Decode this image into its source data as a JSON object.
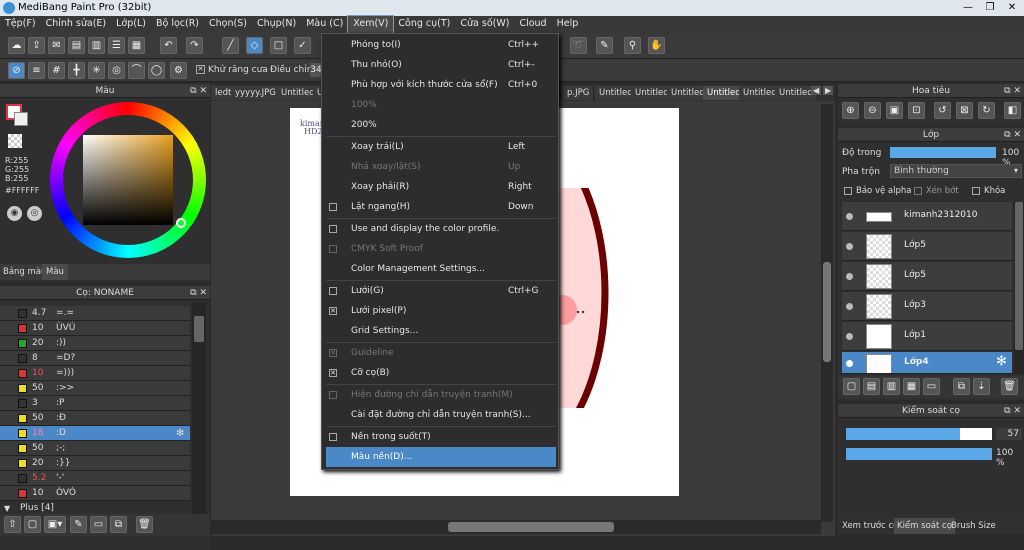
{
  "app": {
    "title": "MediBang Paint Pro (32bit)"
  },
  "window": {
    "minimize": "—",
    "maximize": "❐",
    "close": "✕"
  },
  "menubar": [
    "Tệp(F)",
    "Chỉnh sửa(E)",
    "Lớp(L)",
    "Bộ lọc(R)",
    "Chọn(S)",
    "Chụp(N)",
    "Màu (C)",
    "Xem(V)",
    "Công cụ(T)",
    "Cửa số(W)",
    "Cloud",
    "Help"
  ],
  "toolbar2": {
    "antialias_label": "Khử răng cưa",
    "adjust_label": "Điều chỉnh",
    "adjust_value": "34"
  },
  "canvas_tabs": [
    "ledt",
    "yyyyy.JPG",
    "Untitled",
    "Unt",
    "p.JPG",
    "Untitled",
    "Untitled",
    "Untitled",
    "Untitled",
    "Untitled",
    "Untitled"
  ],
  "canvas_text": {
    "line1": "kiman",
    "line2": "HD2"
  },
  "color_panel": {
    "title": "Màu",
    "r": "R:255",
    "g": "G:255",
    "b": "B:255",
    "hex": "#FFFFFF",
    "tabs": [
      "Bảng màu",
      "Màu"
    ]
  },
  "brush_panel": {
    "title": "Cọ: NONAME",
    "rows": [
      {
        "num": "4.7",
        "name": "=.=",
        "color": "#333333"
      },
      {
        "num": "10",
        "name": "ÙVÚ",
        "color": "#dd3333"
      },
      {
        "num": "20",
        "name": ":))",
        "color": "#22aa22"
      },
      {
        "num": "8",
        "name": "=D?",
        "color": "#333333"
      },
      {
        "num": "10",
        "name": "=)))",
        "color": "#dd3333"
      },
      {
        "num": "50",
        "name": ":>>",
        "color": "#eedd22"
      },
      {
        "num": "3",
        "name": ":P",
        "color": "#333333"
      },
      {
        "num": "50",
        "name": ":Đ",
        "color": "#eedd22"
      },
      {
        "num": "18",
        "name": ":D",
        "color": "#eedd22"
      },
      {
        "num": "50",
        "name": ";-;",
        "color": "#eedd22"
      },
      {
        "num": "20",
        "name": ":}}",
        "color": "#eedd22"
      },
      {
        "num": "5.2",
        "name": "'-'",
        "color": "#333333"
      },
      {
        "num": "10",
        "name": "ÒVÓ",
        "color": "#dd3333"
      }
    ],
    "group_label": "Plus [4]"
  },
  "view_menu": {
    "items": [
      {
        "label": "Phóng to(I)",
        "shortcut": "Ctrl++",
        "check": "",
        "disabled": false
      },
      {
        "label": "Thu nhỏ(O)",
        "shortcut": "Ctrl+-",
        "check": "",
        "disabled": false
      },
      {
        "label": "Phù hợp với kích thước cửa sổ(F)",
        "shortcut": "Ctrl+0",
        "check": "",
        "disabled": false
      },
      {
        "label": "100%",
        "shortcut": "",
        "check": "",
        "disabled": true
      },
      {
        "label": "200%",
        "shortcut": "",
        "check": "",
        "disabled": false
      },
      {
        "label": "Xoay trái(L)",
        "shortcut": "Left",
        "check": "",
        "disabled": false
      },
      {
        "label": "Nhả xoay/lật(S)",
        "shortcut": "Up",
        "check": "",
        "disabled": true
      },
      {
        "label": "Xoay phải(R)",
        "shortcut": "Right",
        "check": "",
        "disabled": false
      },
      {
        "label": "Lật ngang(H)",
        "shortcut": "Down",
        "check": "box",
        "disabled": false
      },
      {
        "label": "Use and display the color profile.",
        "shortcut": "",
        "check": "box",
        "disabled": false
      },
      {
        "label": "CMYK Soft Proof",
        "shortcut": "",
        "check": "box",
        "disabled": true
      },
      {
        "label": "Color Management Settings...",
        "shortcut": "",
        "check": "",
        "disabled": false
      },
      {
        "label": "Lưới(G)",
        "shortcut": "Ctrl+G",
        "check": "box",
        "disabled": false
      },
      {
        "label": "Lưới pixel(P)",
        "shortcut": "",
        "check": "x",
        "disabled": false
      },
      {
        "label": "Grid Settings...",
        "shortcut": "",
        "check": "",
        "disabled": false
      },
      {
        "label": "Guideline",
        "shortcut": "",
        "check": "x",
        "disabled": true
      },
      {
        "label": "Cỡ cọ(B)",
        "shortcut": "",
        "check": "x",
        "disabled": false
      },
      {
        "label": "Hiện đường chỉ dẫn truyện tranh(M)",
        "shortcut": "",
        "check": "box",
        "disabled": true
      },
      {
        "label": "Cài đặt đường chỉ dẫn truyện tranh(S)...",
        "shortcut": "",
        "check": "",
        "disabled": false
      },
      {
        "label": "Nền trong suốt(T)",
        "shortcut": "",
        "check": "box",
        "disabled": false
      },
      {
        "label": "Màu nền(D)...",
        "shortcut": "",
        "check": "",
        "disabled": false
      }
    ]
  },
  "navigator": {
    "title": "Hoa tiêu"
  },
  "layer_panel": {
    "title": "Lớp",
    "opacity_label": "Độ trong",
    "opacity_value": "100 %",
    "opacity": 1.0,
    "blend_label": "Pha trộn",
    "blend_value": "Bình thường",
    "protect_alpha": "Bảo vệ alpha",
    "clip": "Xén bớt",
    "lock": "Khóa",
    "layers": [
      "kimanh2312010",
      "Lớp5",
      "Lớp5",
      "Lớp3",
      "Lớp1",
      "Lớp4"
    ]
  },
  "brush_control": {
    "title": "Kiểm soát cọ",
    "size_value": "57",
    "size_fraction": 0.78,
    "opacity_value": "100 %",
    "opacity_fraction": 1.0
  },
  "bottom_tabs": [
    "Xem trước cọ",
    "Kiểm soát cọ",
    "Brush Size"
  ]
}
